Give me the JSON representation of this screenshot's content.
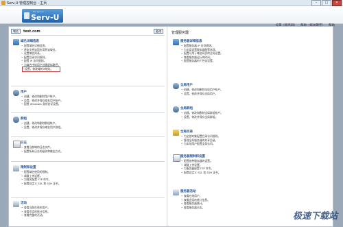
{
  "window": {
    "title": "Serv-U 管理控制台 - 主页",
    "controls": [
      "–",
      "□",
      "✕"
    ]
  },
  "logo": {
    "small": "File Server",
    "big": "Serv-U"
  },
  "toplinks": {
    "settings": "设置（服务器）",
    "help_search": "帮助（按关键字）",
    "help": "帮助"
  },
  "left": {
    "domain_button": "域名",
    "domain_name": "test.com",
    "change_button": "更改",
    "sections": [
      {
        "title": "域名详细信息",
        "icon": "globe-icon",
        "items": [
          "配置域名详细信息。",
          "将安全性选项应用到该域名。",
          "设置域名列表。",
          "配置目录访问规则。",
          "配置 IP 访问规则。",
          "为域名中的用户创建虚拟路径。",
          "设置，修改域的IP地址。"
        ],
        "boxed_index": 6
      },
      {
        "title": "用户",
        "icon": "user-icon",
        "items": [
          "创建，修改和删除用户帐户。",
          "设置，修改并保存域名用户账户。",
          "配置 Windows 身份验证设置。"
        ]
      },
      {
        "title": "群组",
        "icon": "users-icon",
        "items": [
          "创建，修改和删除群组帐户。",
          "设置，修改并保存域名用户群组。"
        ]
      },
      {
        "title": "日志",
        "icon": "log-icon",
        "items": [
          "查看当前域的日志文件。",
          "配置所有日志的级别和输出方式。"
        ]
      },
      {
        "title": "限制和设置",
        "icon": "settings-icon",
        "items": [
          "配置域名使用的限制。",
          "调整上传设置。",
          "为域名配置 FTP 命令。",
          "配置自定义 SSL 和 SSH 证书。"
        ]
      },
      {
        "title": "活动",
        "icon": "activity-icon",
        "items": [
          "查看当前在线的用户。",
          "查看会话的统计信息。",
          "查看完整的活动。"
        ]
      }
    ]
  },
  "right": {
    "title": "管理服务器",
    "sections": [
      {
        "title": "服务器详细信息",
        "icon": "server-icon",
        "items": [
          "配置服务器 IP 访问规则。",
          "为全局设置服务器配置选项。",
          "配置可用于域名网页的全局设置。",
          "查看服务器运行的时间。",
          "配置服务器的个性化设置。"
        ]
      },
      {
        "title": "全局用户",
        "icon": "global-user-icon",
        "items": [
          "创建，修改和删除全局用户帐户。",
          "设置，修改并保存全局用户。"
        ]
      },
      {
        "title": "全局群组",
        "icon": "global-group-icon",
        "items": [
          "创建，修改和删除全局群组帐户。",
          "设置，修改并保存全局群组。"
        ]
      },
      {
        "title": "全局目录",
        "icon": "folder-icon",
        "items": [
          "为全部对象配置目录访问规则。",
          "管理全局服务器的共享目录。",
          "为本地用户配置全局访问。"
        ]
      },
      {
        "title": "服务器限制和设置",
        "icon": "server-limits-icon",
        "items": [
          "配置各种服务器的设置。",
          "调整上传设置。",
          "为服务器配置 FTP 命令。",
          "配置自定义 SSL 和 SSH 证书。"
        ]
      },
      {
        "title": "服务器活动",
        "icon": "server-activity-icon",
        "items": [
          "查看在线用户。",
          "查看会话的统计信息。",
          "查看服务器统计。",
          "查看服务器日志。"
        ]
      }
    ]
  },
  "watermark": "极速下载站"
}
